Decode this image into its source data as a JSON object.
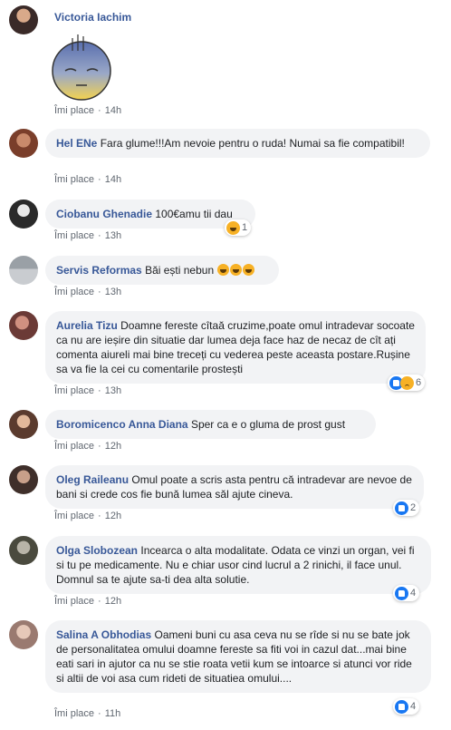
{
  "like_label": "Îmi place",
  "comments": [
    {
      "author": "Victoria Iachim",
      "text": "",
      "time": "14h"
    },
    {
      "author": "Hel ENe",
      "text": "Fara glume!!!Am nevoie pentru o ruda! Numai sa fie compatibil!",
      "time": "14h"
    },
    {
      "author": "Ciobanu Ghenadie",
      "text": "100€amu tii dau",
      "time": "13h",
      "reactions": {
        "icons": [
          "haha-icon"
        ],
        "count": "1"
      }
    },
    {
      "author": "Servis Reformas",
      "text": "Băi ești nebun",
      "time": "13h"
    },
    {
      "author": "Aurelia Tizu",
      "text": "Doamne fereste cîtaă cruzime,poate omul intradevar socoate ca nu are ieșire din situatie dar lumea deja face haz de necaz de cît ați comenta aiureli mai bine treceți cu vederea peste aceasta postare.Rușine sa va fie la cei cu comentarile prostești",
      "time": "13h",
      "reactions": {
        "icons": [
          "like-icon",
          "sad-icon"
        ],
        "count": "6"
      }
    },
    {
      "author": "Boromicenco Anna Diana",
      "text": "Sper ca e o gluma de prost gust",
      "time": "12h"
    },
    {
      "author": "Oleg Raileanu",
      "text": "Omul poate a scris asta pentru că intradevar are nevoe de bani si crede cos fie bună lumea săl ajute cineva.",
      "time": "12h",
      "reactions": {
        "icons": [
          "like-icon"
        ],
        "count": "2"
      }
    },
    {
      "author": "Olga Slobozean",
      "text": "Incearca o alta modalitate. Odata ce vinzi un organ, vei fi si tu pe medicamente. Nu e chiar usor cind lucrul a 2 rinichi, il face unul. Domnul sa te ajute sa-ti dea alta solutie.",
      "time": "12h",
      "reactions": {
        "icons": [
          "like-icon"
        ],
        "count": "4"
      }
    },
    {
      "author": "Salina A Obhodias",
      "text": "Oameni buni cu asa ceva nu se rîde si nu se bate jok de personalitatea omului doamne fereste sa fiti voi in cazul dat...mai bine eati sari in ajutor ca nu se stie roata vetii kum se intoarce si atunci vor ride si altii de voi asa cum rideti de situatiea omului....",
      "time": "11h",
      "reactions": {
        "icons": [
          "like-icon"
        ],
        "count": "4"
      }
    }
  ]
}
